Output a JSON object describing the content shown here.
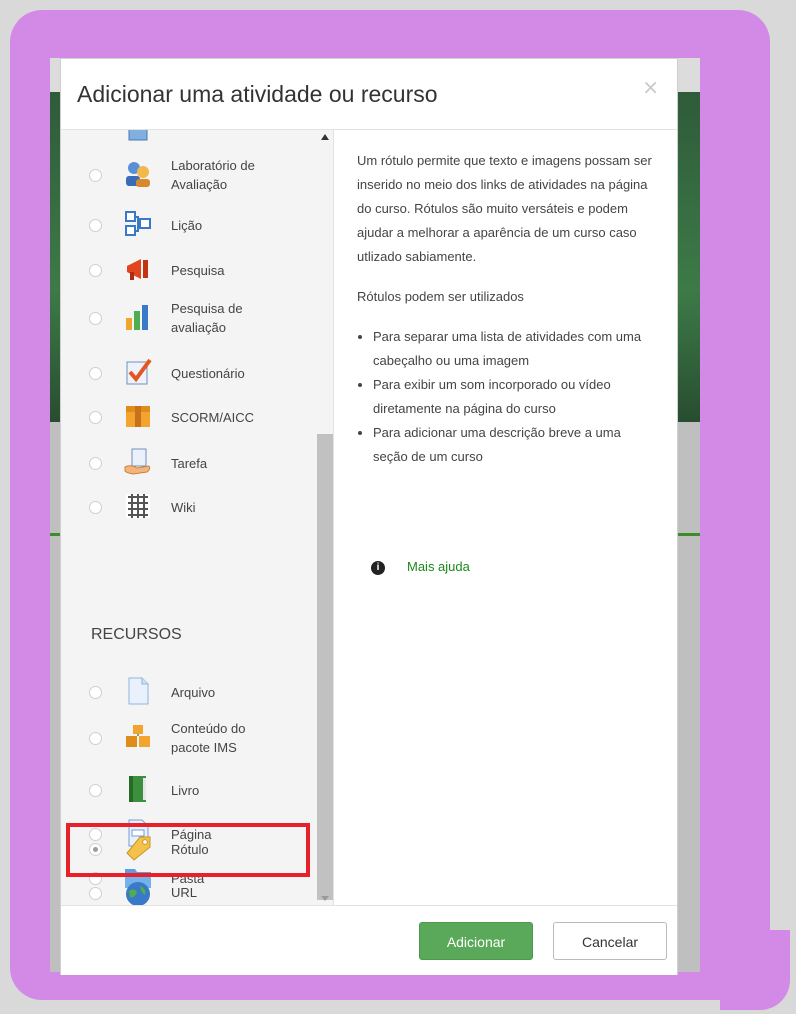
{
  "dialog": {
    "title": "Adicionar uma atividade ou recurso",
    "close": "×"
  },
  "options": [
    {
      "label": "Laboratório de\nAvaliação",
      "icon": "workshop-icon",
      "selected": false
    },
    {
      "label": "Lição",
      "icon": "lesson-icon",
      "selected": false
    },
    {
      "label": "Pesquisa",
      "icon": "megaphone-icon",
      "selected": false
    },
    {
      "label": "Pesquisa de\navaliação",
      "icon": "bar-chart-icon",
      "selected": false
    },
    {
      "label": "Questionário",
      "icon": "quiz-checkmark-icon",
      "selected": false
    },
    {
      "label": "SCORM/AICC",
      "icon": "scorm-package-icon",
      "selected": false
    },
    {
      "label": "Tarefa",
      "icon": "assignment-hand-icon",
      "selected": false
    },
    {
      "label": "Wiki",
      "icon": "wiki-puzzle-icon",
      "selected": false
    }
  ],
  "resources_heading": "RECURSOS",
  "resources": [
    {
      "label": "Arquivo",
      "icon": "file-icon",
      "selected": false
    },
    {
      "label": "Conteúdo do\npacote IMS",
      "icon": "ims-package-icon",
      "selected": false
    },
    {
      "label": "Livro",
      "icon": "book-icon",
      "selected": false
    },
    {
      "label": "Página",
      "icon": "page-icon",
      "selected": false
    },
    {
      "label": "Pasta",
      "icon": "folder-icon",
      "selected": false
    },
    {
      "label": "Rótulo",
      "icon": "label-tag-icon",
      "selected": true
    },
    {
      "label": "URL",
      "icon": "globe-icon",
      "selected": false
    }
  ],
  "help": {
    "paragraph1": "Um rótulo permite que texto e imagens possam ser inserido no meio dos links de atividades na página do curso. Rótulos são muito versáteis e podem ajudar a melhorar a aparência de um curso caso utlizado sabiamente.",
    "paragraph2": "Rótulos podem ser utilizados",
    "bullets": [
      "Para separar uma lista de atividades com uma cabeçalho ou uma imagem",
      "Para exibir um som incorporado ou vídeo diretamente na página do curso",
      "Para adicionar uma descrição breve a uma seção de um curso"
    ],
    "more_link": "Mais ajuda"
  },
  "footer": {
    "add_label": "Adicionar",
    "cancel_label": "Cancelar"
  },
  "colors": {
    "frame": "#d28ae6",
    "highlight": "#e8202a",
    "primary_button": "#5aa95a",
    "link": "#1a8a1a"
  }
}
